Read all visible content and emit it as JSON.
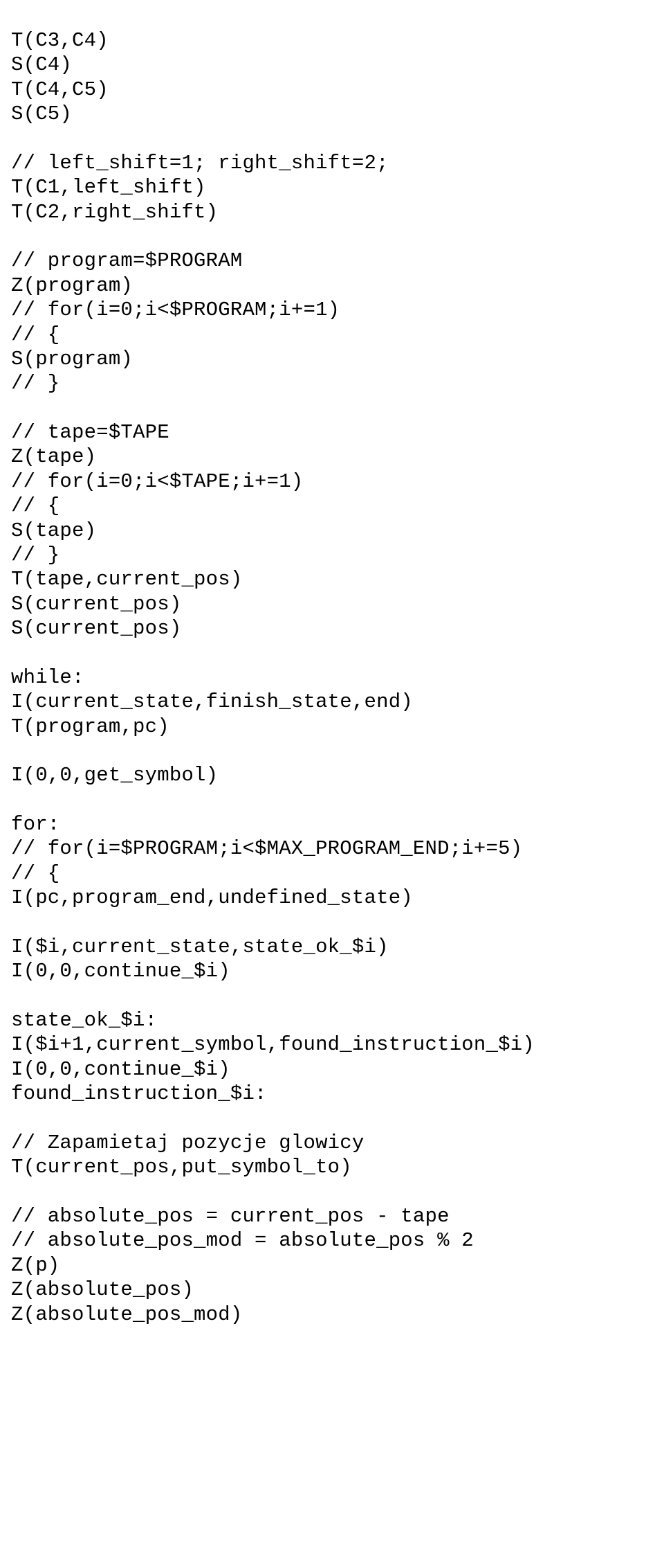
{
  "code": "T(C3,C4)\nS(C4)\nT(C4,C5)\nS(C5)\n\n// left_shift=1; right_shift=2;\nT(C1,left_shift)\nT(C2,right_shift)\n\n// program=$PROGRAM\nZ(program)\n// for(i=0;i<$PROGRAM;i+=1)\n// {\nS(program)\n// }\n\n// tape=$TAPE\nZ(tape)\n// for(i=0;i<$TAPE;i+=1)\n// {\nS(tape)\n// }\nT(tape,current_pos)\nS(current_pos)\nS(current_pos)\n\nwhile:\nI(current_state,finish_state,end)\nT(program,pc)\n\nI(0,0,get_symbol)\n\nfor:\n// for(i=$PROGRAM;i<$MAX_PROGRAM_END;i+=5)\n// {\nI(pc,program_end,undefined_state)\n\nI($i,current_state,state_ok_$i)\nI(0,0,continue_$i)\n\nstate_ok_$i:\nI($i+1,current_symbol,found_instruction_$i)\nI(0,0,continue_$i)\nfound_instruction_$i:\n\n// Zapamietaj pozycje glowicy\nT(current_pos,put_symbol_to)\n\n// absolute_pos = current_pos - tape\n// absolute_pos_mod = absolute_pos % 2\nZ(p)\nZ(absolute_pos)\nZ(absolute_pos_mod)"
}
